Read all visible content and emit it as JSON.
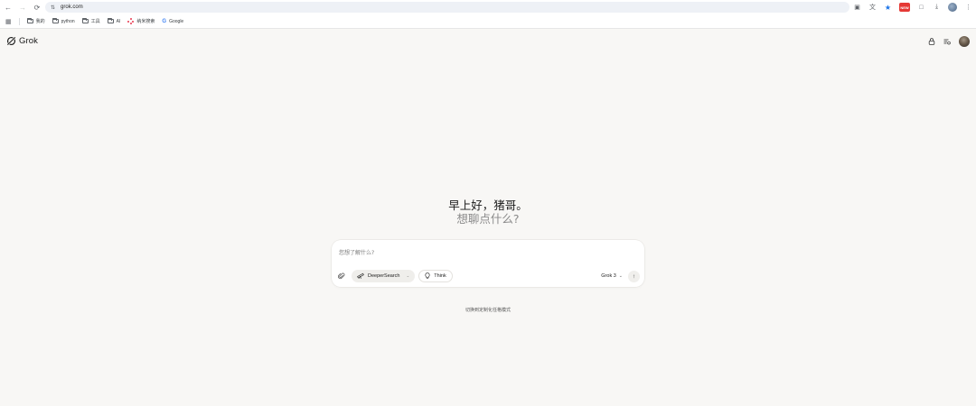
{
  "browser": {
    "url": "grok.com",
    "bookmarks": [
      {
        "label": "我的",
        "type": "folder"
      },
      {
        "label": "python",
        "type": "folder"
      },
      {
        "label": "工具",
        "type": "folder"
      },
      {
        "label": "AI",
        "type": "folder"
      },
      {
        "label": "纳米搜索",
        "type": "link",
        "icon": "nano-search-icon"
      },
      {
        "label": "Google",
        "type": "link",
        "icon": "google-icon"
      }
    ],
    "extension_badge": "NEW"
  },
  "app": {
    "logo_text": "Grok"
  },
  "greeting": {
    "line1": "早上好，猪哥。",
    "line2": "想聊点什么?"
  },
  "composer": {
    "placeholder": "您想了解什么?",
    "deepersearch_label": "DeeperSearch",
    "think_label": "Think",
    "model_label": "Grok 3"
  },
  "footer": {
    "link_text": "切换到定制化任格模式"
  },
  "colors": {
    "page_bg": "#f8f7f5",
    "card_bg": "#ffffff",
    "pill_bg": "#efeeeb",
    "greeting_secondary": "#8a8a8a"
  }
}
